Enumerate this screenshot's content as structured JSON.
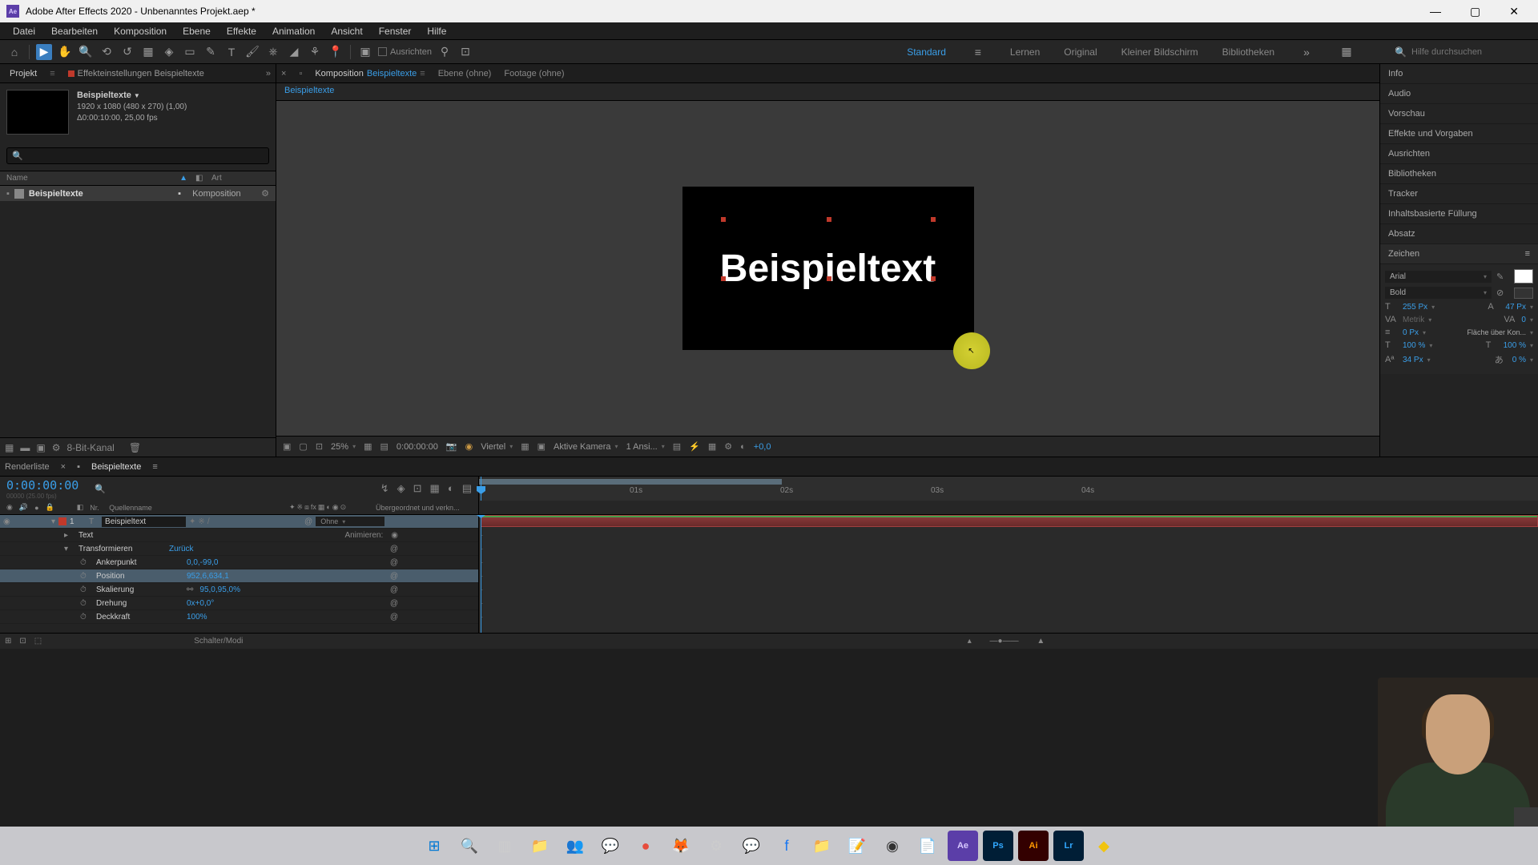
{
  "window": {
    "title": "Adobe After Effects 2020 - Unbenanntes Projekt.aep *",
    "icon_text": "Ae"
  },
  "menu": [
    "Datei",
    "Bearbeiten",
    "Komposition",
    "Ebene",
    "Effekte",
    "Animation",
    "Ansicht",
    "Fenster",
    "Hilfe"
  ],
  "toolbar": {
    "align_label": "Ausrichten"
  },
  "workspaces": {
    "items": [
      "Standard",
      "Lernen",
      "Original",
      "Kleiner Bildschirm",
      "Bibliotheken"
    ],
    "active": "Standard",
    "search_placeholder": "Hilfe durchsuchen"
  },
  "project_panel": {
    "tabs": {
      "project": "Projekt",
      "fx": "Effekteinstellungen Beispieltexte"
    },
    "comp_name": "Beispieltexte",
    "meta_line1": "1920 x 1080 (480 x 270) (1,00)",
    "meta_line2": "Δ0:00:10:00, 25,00 fps",
    "cols": {
      "name": "Name",
      "type": "Art"
    },
    "items": [
      {
        "name": "Beispieltexte",
        "type": "Komposition"
      }
    ],
    "bit_label": "8-Bit-Kanal"
  },
  "comp_viewer": {
    "tabs": {
      "comp_prefix": "Komposition",
      "comp_name": "Beispieltexte",
      "layer": "Ebene (ohne)",
      "footage": "Footage (ohne)"
    },
    "breadcrumb": "Beispieltexte",
    "canvas_text": "Beispieltext",
    "footer": {
      "zoom": "25%",
      "timecode": "0:00:00:00",
      "res": "Viertel",
      "camera": "Aktive Kamera",
      "views": "1 Ansi...",
      "exposure": "+0,0"
    }
  },
  "right_panels": [
    "Info",
    "Audio",
    "Vorschau",
    "Effekte und Vorgaben",
    "Ausrichten",
    "Bibliotheken",
    "Tracker",
    "Inhaltsbasierte Füllung",
    "Absatz"
  ],
  "character": {
    "title": "Zeichen",
    "font": "Arial",
    "style": "Bold",
    "size": "255 Px",
    "leading": "47 Px",
    "kerning": "Metrik",
    "tracking": "0",
    "stroke_width": "0 Px",
    "stroke_mode": "Fläche über Kon...",
    "vscale": "100 %",
    "hscale": "100 %",
    "baseline": "34 Px",
    "tsume": "0 %"
  },
  "timeline": {
    "tabs": {
      "render": "Renderliste",
      "comp": "Beispieltexte"
    },
    "timecode": "0:00:00:00",
    "sub_timecode": "00000 (25.00 fps)",
    "cols": {
      "num": "Nr.",
      "source": "Quellenname",
      "parent": "Übergeordnet und verkn..."
    },
    "ticks": [
      "01s",
      "02s",
      "03s",
      "04s"
    ],
    "layer": {
      "num": "1",
      "name": "Beispieltext",
      "parent": "Ohne",
      "groups": {
        "text": "Text",
        "transform": "Transformieren",
        "animate": "Animieren:"
      },
      "reset": "Zurück",
      "props": {
        "anchor": {
          "label": "Ankerpunkt",
          "val": "0,0,-99,0"
        },
        "position": {
          "label": "Position",
          "val": "952,6,634,1"
        },
        "scale": {
          "label": "Skalierung",
          "val": "95,0,95,0%"
        },
        "rotation": {
          "label": "Drehung",
          "val": "0x+0,0°"
        },
        "opacity": {
          "label": "Deckkraft",
          "val": "100%"
        }
      }
    },
    "footer_label": "Schalter/Modi"
  }
}
